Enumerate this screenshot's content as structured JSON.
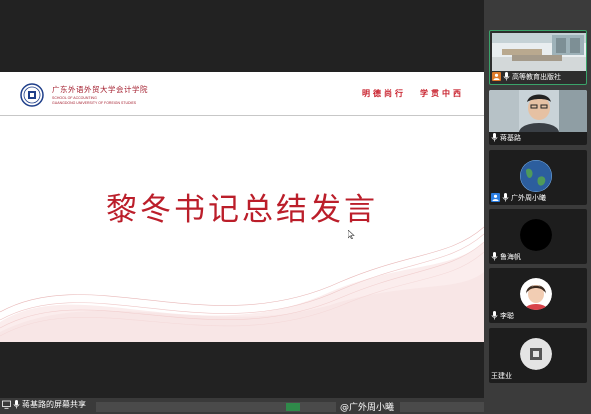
{
  "slide": {
    "school_cn": "广东外语外贸大学会计学院",
    "school_en_line1": "SCHOOL OF ACCOUNTING",
    "school_en_line2": "GUANGDONG UNIVERSITY OF FOREIGN STUDIES",
    "motto_left": "明德尚行",
    "motto_right": "学贯中西",
    "title": "黎冬书记总结发言"
  },
  "participants": [
    {
      "name": "高等教育出版社",
      "type": "video-room",
      "active": true
    },
    {
      "name": "蒋基路",
      "type": "video-person",
      "active": false
    },
    {
      "name": "广外周小曦",
      "type": "avatar-earth",
      "active": false
    },
    {
      "name": "鲁海帆",
      "type": "avatar-black",
      "active": false
    },
    {
      "name": "李聪",
      "type": "avatar-person",
      "active": false
    },
    {
      "name": "王建业",
      "type": "avatar-gray",
      "active": false
    }
  ],
  "bottom_bar": {
    "share_text": "蒋基路的屏幕共享",
    "chat_preview": "@广外周小曦"
  },
  "colors": {
    "accent_red": "#bb1e2a",
    "active_border": "#3aa36a",
    "sidebar_bg": "#3b3b3b"
  }
}
